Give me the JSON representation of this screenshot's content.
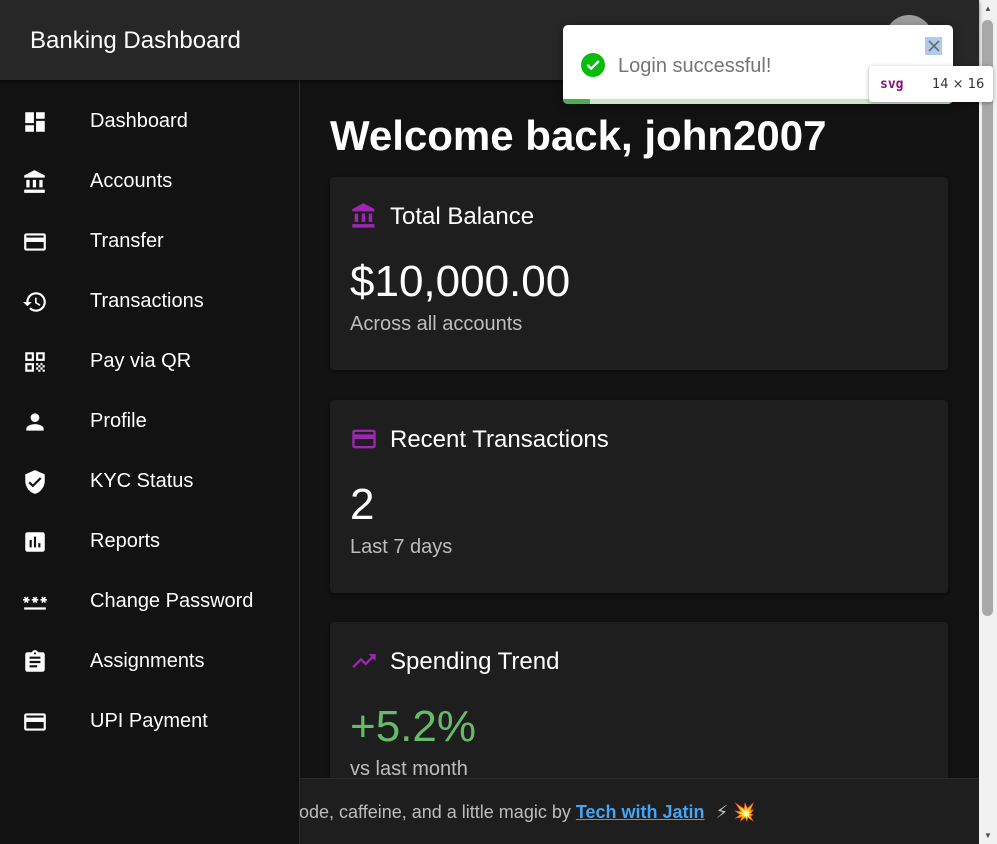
{
  "app": {
    "title": "Banking Dashboard"
  },
  "sidebar": {
    "items": [
      {
        "label": "Dashboard",
        "icon": "dashboard-icon"
      },
      {
        "label": "Accounts",
        "icon": "bank-icon"
      },
      {
        "label": "Transfer",
        "icon": "credit-card-icon"
      },
      {
        "label": "Transactions",
        "icon": "history-icon"
      },
      {
        "label": "Pay via QR",
        "icon": "qr-code-icon"
      },
      {
        "label": "Profile",
        "icon": "person-icon"
      },
      {
        "label": "KYC Status",
        "icon": "verified-shield-icon"
      },
      {
        "label": "Reports",
        "icon": "bar-chart-icon"
      },
      {
        "label": "Change Password",
        "icon": "password-icon"
      },
      {
        "label": "Assignments",
        "icon": "clipboard-icon"
      },
      {
        "label": "UPI Payment",
        "icon": "credit-card-icon"
      }
    ]
  },
  "main": {
    "welcome": "Welcome back, john2007",
    "cards": [
      {
        "title": "Total Balance",
        "value": "$10,000.00",
        "subtitle": "Across all accounts",
        "icon": "bank-icon"
      },
      {
        "title": "Recent Transactions",
        "value": "2",
        "subtitle": "Last 7 days",
        "icon": "credit-card-icon"
      },
      {
        "title": "Spending Trend",
        "value": "+5.2%",
        "subtitle": "vs last month",
        "icon": "trending-up-icon"
      }
    ]
  },
  "footer": {
    "text": "code, caffeine, and a little magic by",
    "link": "Tech with Jatin",
    "emoji": "⚡ 💥"
  },
  "toast": {
    "message": "Login successful!",
    "progress": 0.07
  },
  "inspect_tooltip": {
    "tag": "svg",
    "dimensions": "14 × 16"
  },
  "colors": {
    "accent": "#9c27b0",
    "success": "#4caf50",
    "positive_value": "#66bb6a",
    "link": "#42a5f5",
    "appbar_bg": "#272727",
    "card_bg": "#1e1e1e",
    "page_bg": "#121212"
  }
}
